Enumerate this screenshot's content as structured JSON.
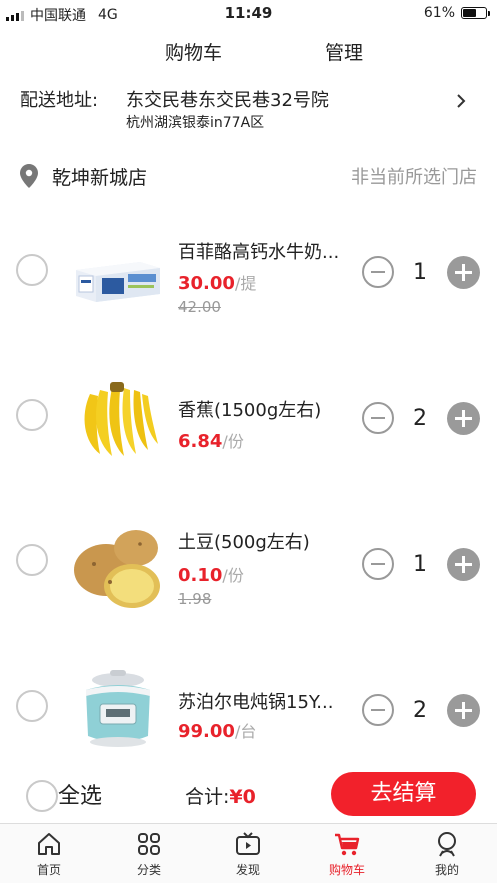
{
  "status_bar": {
    "carrier": "中国联通",
    "network": "4G",
    "time": "11:49",
    "battery": "61%",
    "battery_level": 0.61
  },
  "header": {
    "title": "购物车",
    "manage": "管理"
  },
  "address": {
    "label": "配送地址:",
    "line1": "东交民巷东交民巷32号院",
    "line2": "杭州湖滨银泰in77A区"
  },
  "store": {
    "name": "乾坤新城店",
    "other_store": "非当前所选门店"
  },
  "items": [
    {
      "name": "百菲酪高钙水牛奶...",
      "price": "30.00",
      "unit": "/提",
      "original_price": "42.00",
      "quantity": "1",
      "icon": "milk-box-image"
    },
    {
      "name": "香蕉(1500g左右)",
      "price": "6.84",
      "unit": "/份",
      "original_price": "",
      "quantity": "2",
      "icon": "banana-image"
    },
    {
      "name": "土豆(500g左右)",
      "price": "0.10",
      "unit": "/份",
      "original_price": "1.98",
      "quantity": "1",
      "icon": "potato-image"
    },
    {
      "name": "苏泊尔电炖锅15Y...",
      "price": "99.00",
      "unit": "/台",
      "original_price": "",
      "quantity": "2",
      "icon": "stew-pot-image"
    }
  ],
  "footer": {
    "select_all": "全选",
    "total_label": "合计:",
    "total_amount": "¥0",
    "checkout": "去结算"
  },
  "tabs": [
    {
      "label": "首页",
      "icon": "home-icon"
    },
    {
      "label": "分类",
      "icon": "category-icon"
    },
    {
      "label": "发现",
      "icon": "discover-icon"
    },
    {
      "label": "购物车",
      "icon": "cart-icon",
      "active": true
    },
    {
      "label": "我的",
      "icon": "profile-icon"
    }
  ],
  "colors": {
    "accent": "#e8222b",
    "checkout_bg": "#f2212b",
    "muted": "#999999"
  }
}
